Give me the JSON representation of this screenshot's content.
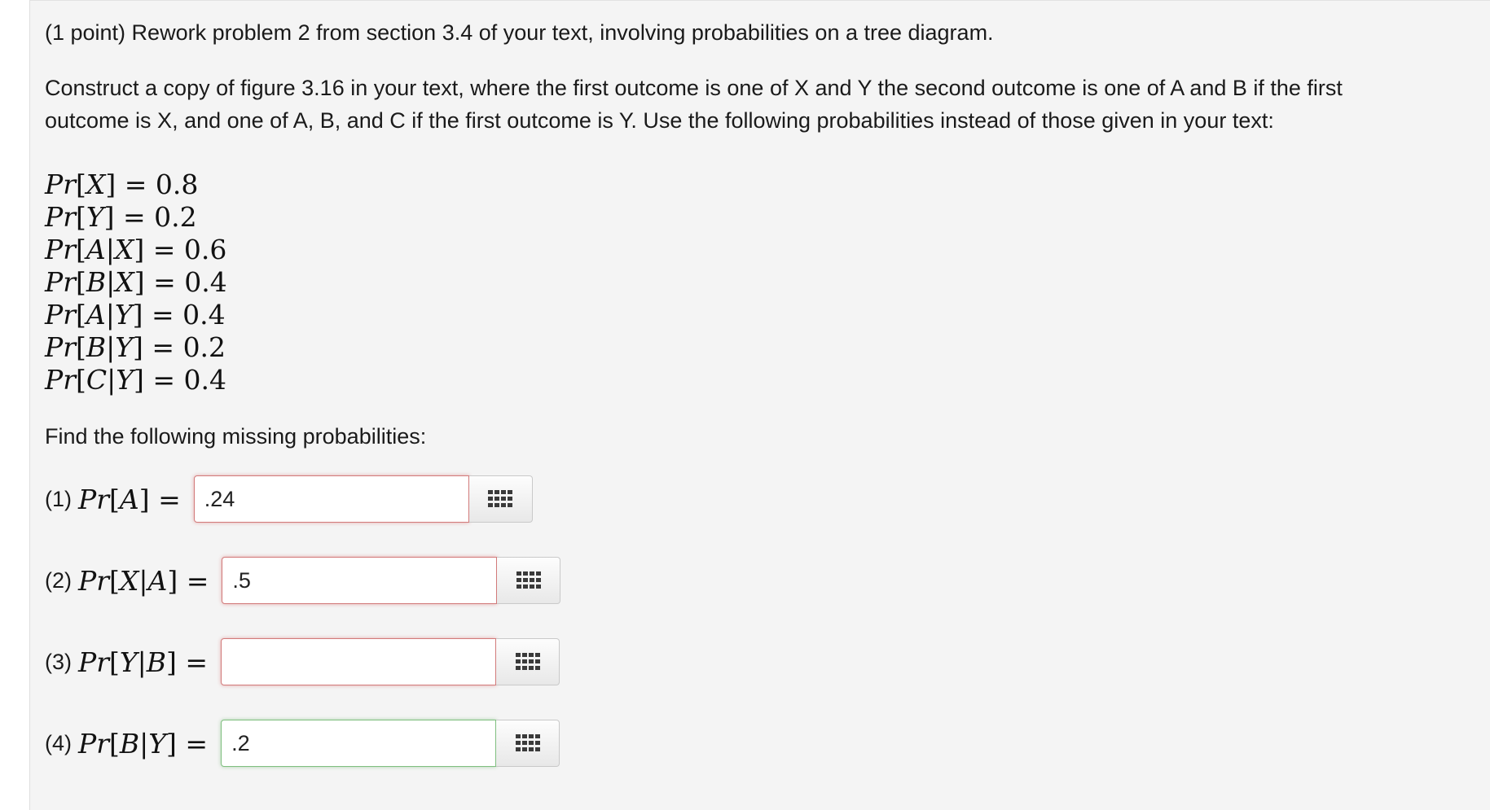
{
  "problem": {
    "intro": "(1 point) Rework problem 2 from section 3.4 of your text, involving probabilities on a tree diagram.",
    "instructions_line1": "Construct a copy of figure 3.16 in your text, where the first outcome is one of X and Y the second outcome is one of A and B if the first",
    "instructions_line2": "outcome is X, and one of A, B, and C if the first outcome is Y. Use the following probabilities instead of those given in your text:",
    "given": [
      {
        "event": "X",
        "condition": "",
        "value": "0.8"
      },
      {
        "event": "Y",
        "condition": "",
        "value": "0.2"
      },
      {
        "event": "A",
        "condition": "X",
        "value": "0.6"
      },
      {
        "event": "B",
        "condition": "X",
        "value": "0.4"
      },
      {
        "event": "A",
        "condition": "Y",
        "value": "0.4"
      },
      {
        "event": "B",
        "condition": "Y",
        "value": "0.2"
      },
      {
        "event": "C",
        "condition": "Y",
        "value": "0.4"
      }
    ],
    "find_prompt": "Find the following missing probabilities:"
  },
  "questions": [
    {
      "number": "(1)",
      "event": "A",
      "condition": "",
      "answer": ".24",
      "status": "incorrect"
    },
    {
      "number": "(2)",
      "event": "X",
      "condition": "A",
      "answer": ".5",
      "status": "incorrect"
    },
    {
      "number": "(3)",
      "event": "Y",
      "condition": "B",
      "answer": "",
      "status": "incorrect"
    },
    {
      "number": "(4)",
      "event": "B",
      "condition": "Y",
      "answer": ".2",
      "status": "correct"
    }
  ],
  "colors": {
    "incorrect_border": "#d27a7a",
    "correct_border": "#7fbf7f",
    "panel_background": "#f4f4f4"
  },
  "icons": {
    "equation_editor": "grid-keypad-icon"
  }
}
